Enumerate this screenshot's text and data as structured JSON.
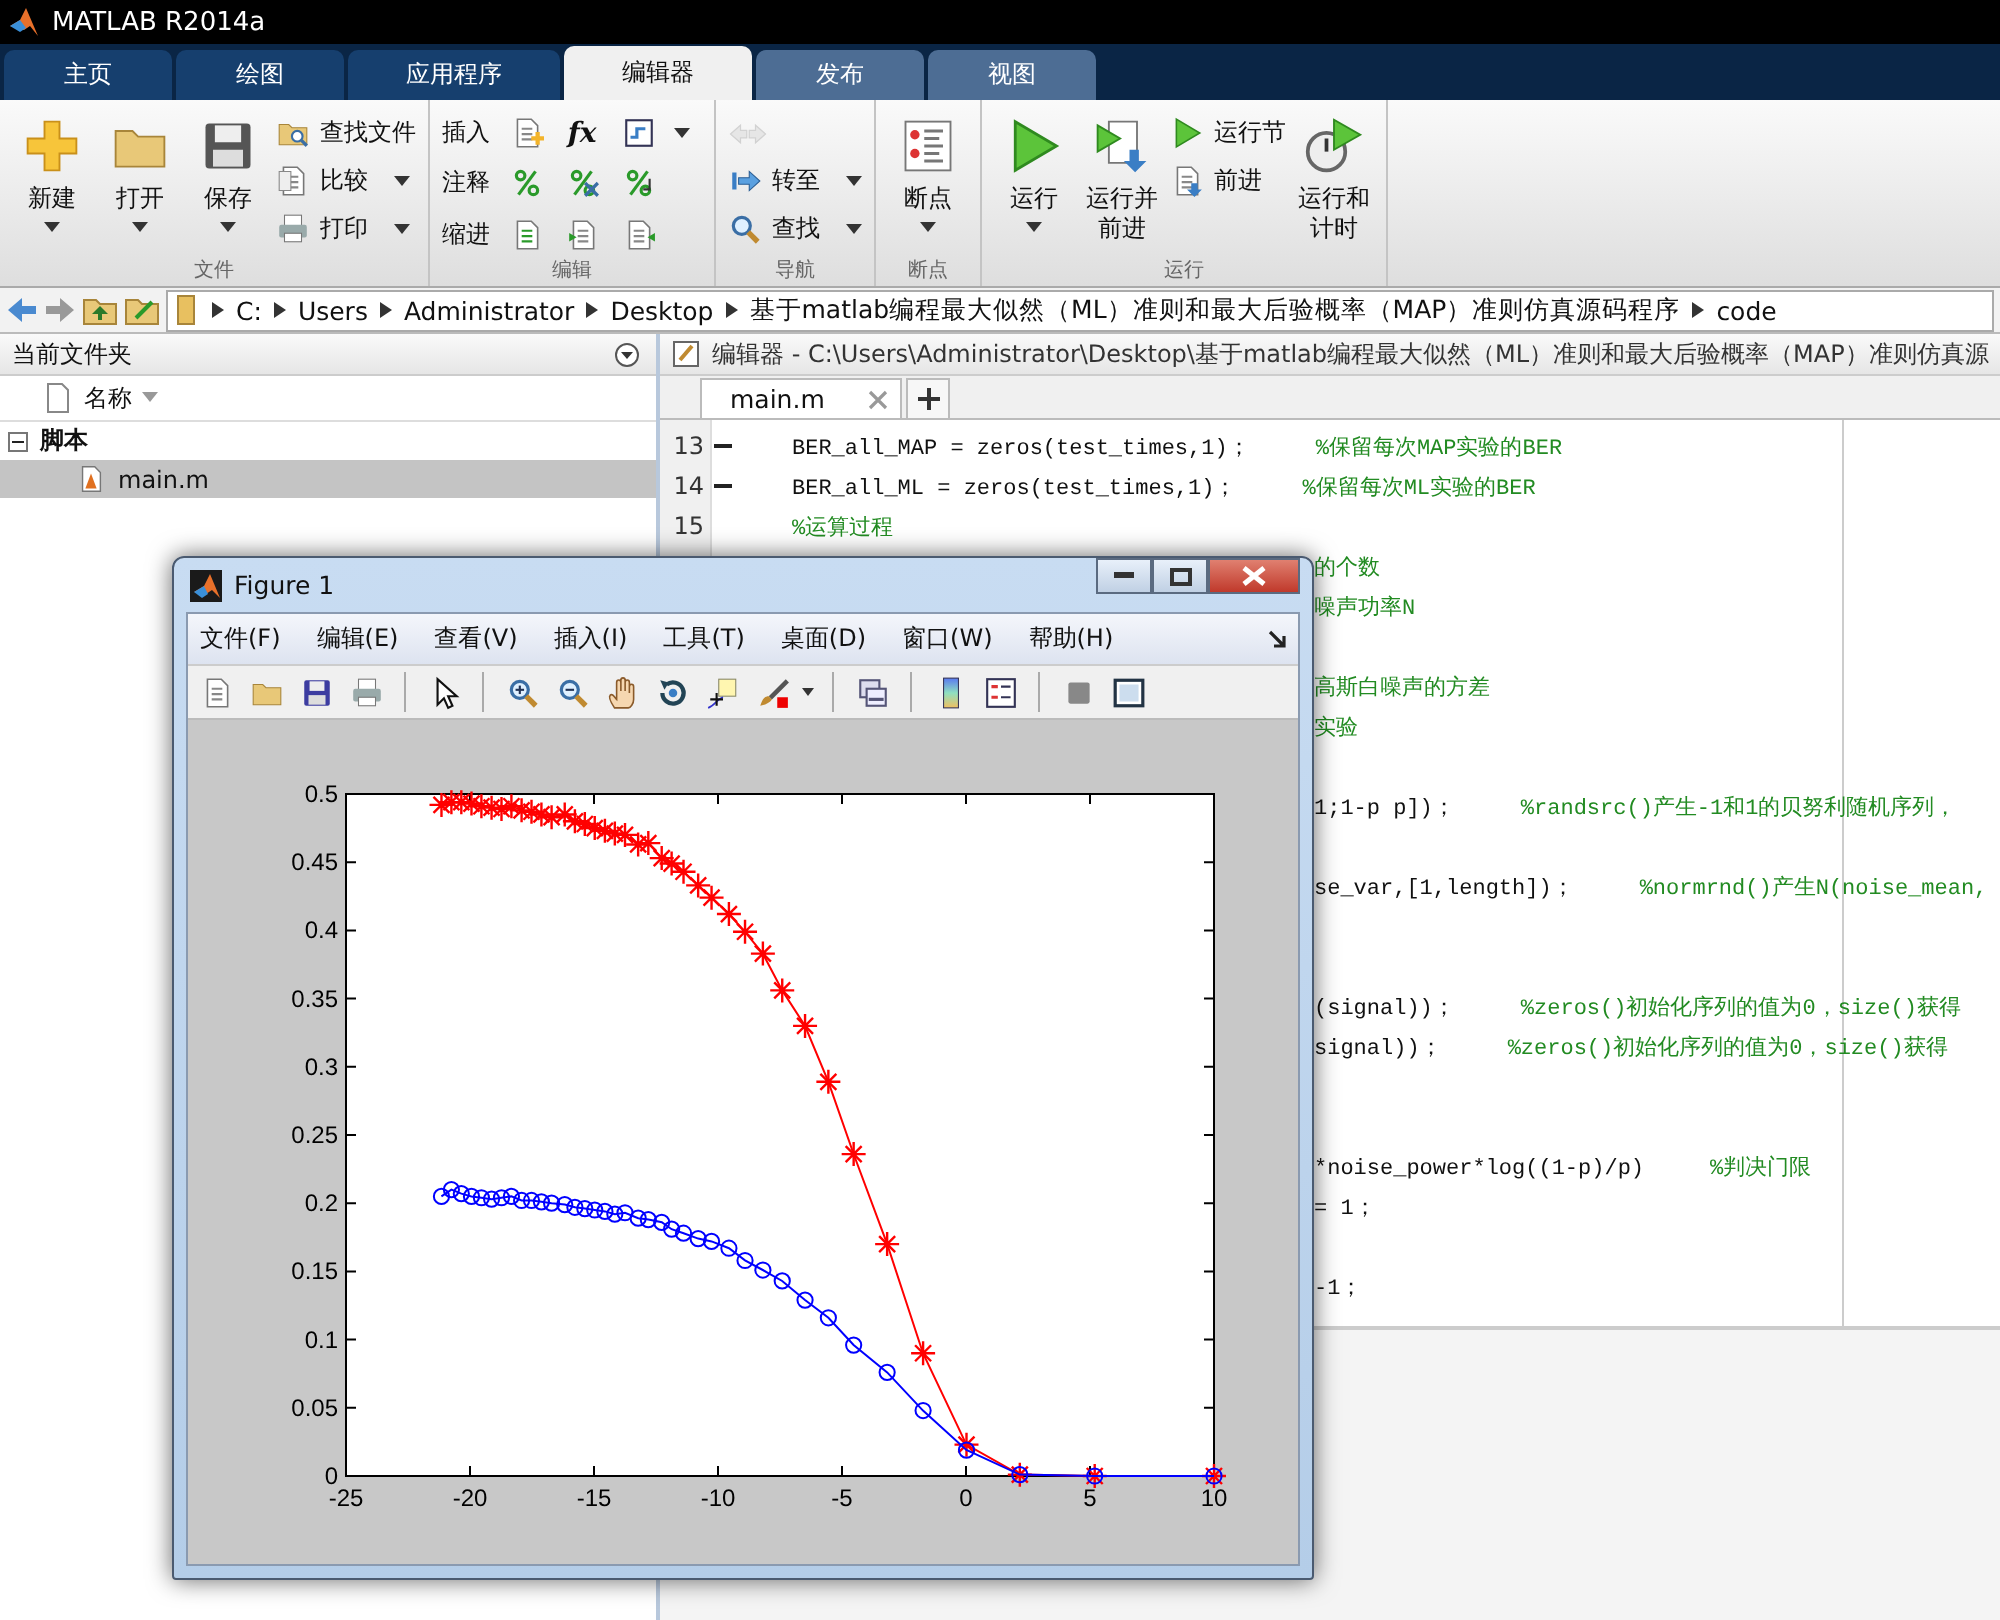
{
  "window": {
    "title": "MATLAB R2014a"
  },
  "tabs": [
    {
      "label": "主页",
      "kind": "global",
      "selected": false
    },
    {
      "label": "绘图",
      "kind": "global",
      "selected": false
    },
    {
      "label": "应用程序",
      "kind": "global",
      "selected": false
    },
    {
      "label": "编辑器",
      "kind": "contextual",
      "selected": true
    },
    {
      "label": "发布",
      "kind": "contextual",
      "selected": false
    },
    {
      "label": "视图",
      "kind": "contextual",
      "selected": false
    }
  ],
  "toolstrip": {
    "sections": [
      {
        "title": "文件",
        "items": [
          {
            "kind": "large",
            "label": "新建",
            "dropdown": true
          },
          {
            "kind": "large",
            "label": "打开",
            "dropdown": true
          },
          {
            "kind": "large",
            "label": "保存",
            "dropdown": true
          },
          {
            "kind": "stack",
            "rows": [
              {
                "kind": "button",
                "label": "查找文件",
                "dropdown": false
              },
              {
                "kind": "button",
                "label": "比较",
                "dropdown": true
              },
              {
                "kind": "button",
                "label": "打印",
                "dropdown": true
              }
            ]
          }
        ]
      },
      {
        "title": "编辑",
        "items": [
          {
            "kind": "grid",
            "labels": [
              "插入",
              "注释",
              "缩进"
            ],
            "glyph": "fx"
          }
        ]
      },
      {
        "title": "导航",
        "items": [
          {
            "kind": "stack",
            "rows": [
              {
                "kind": "arrows",
                "disabled": true
              },
              {
                "kind": "button",
                "label": "转至",
                "dropdown": true
              },
              {
                "kind": "button",
                "label": "查找",
                "dropdown": true
              }
            ]
          }
        ]
      },
      {
        "title": "断点",
        "items": [
          {
            "kind": "large",
            "label": "断点",
            "dropdown": true
          }
        ]
      },
      {
        "title": "运行",
        "items": [
          {
            "kind": "large",
            "label": "运行",
            "dropdown": true
          },
          {
            "kind": "large",
            "label": "运行并前进",
            "dropdown": false
          },
          {
            "kind": "stack",
            "rows": [
              {
                "kind": "button",
                "label": "运行节",
                "dropdown": false
              },
              {
                "kind": "button",
                "label": "前进",
                "dropdown": false
              }
            ]
          },
          {
            "kind": "large",
            "label": "运行和计时",
            "dropdown": false
          }
        ]
      }
    ]
  },
  "address": {
    "segments": [
      "C:",
      "Users",
      "Administrator",
      "Desktop",
      "基于matlab编程最大似然（ML）准则和最大后验概率（MAP）准则仿真源码程序",
      "code"
    ]
  },
  "folder_panel": {
    "title": "当前文件夹",
    "column": "名称",
    "tree": [
      {
        "label": "脚本",
        "expanded": true,
        "selected": false,
        "children": [
          {
            "label": "main.m",
            "selected": true
          }
        ]
      }
    ]
  },
  "editor": {
    "title": "编辑器 - C:\\Users\\Administrator\\Desktop\\基于matlab编程最大似然（ML）准则和最大后验概率（MAP）准则仿真源",
    "tabs": [
      {
        "label": "main.m",
        "selected": true
      }
    ],
    "lines": [
      {
        "kind": "full",
        "number": "13",
        "executable": true,
        "code": "BER_all_MAP = zeros(test_times,1)；",
        "comment": "%保留每次MAP实验的BER"
      },
      {
        "kind": "full",
        "number": "14",
        "executable": true,
        "code": "BER_all_ML = zeros(test_times,1)；",
        "comment": "%保留每次ML实验的BER"
      },
      {
        "kind": "full",
        "number": "15",
        "executable": false,
        "comment": "%运算过程"
      },
      {
        "kind": "fragment",
        "comment": "的个数"
      },
      {
        "kind": "fragment",
        "comment": "噪声功率N"
      },
      {
        "kind": "blank"
      },
      {
        "kind": "fragment",
        "comment": "高斯白噪声的方差"
      },
      {
        "kind": "fragment",
        "comment": "实验"
      },
      {
        "kind": "blank"
      },
      {
        "kind": "fragment",
        "code": "1;1-p p])；",
        "comment": "%randsrc()产生-1和1的贝努利随机序列，"
      },
      {
        "kind": "blank"
      },
      {
        "kind": "fragment",
        "code": "se_var,[1,length])；",
        "comment": "%normrnd()产生N(noise_mean,"
      },
      {
        "kind": "blank"
      },
      {
        "kind": "blank"
      },
      {
        "kind": "fragment",
        "code": "(signal))；",
        "comment": "%zeros()初始化序列的值为0，size()获得"
      },
      {
        "kind": "fragment",
        "code": "signal))；",
        "comment": "%zeros()初始化序列的值为0，size()获得"
      },
      {
        "kind": "blank"
      },
      {
        "kind": "blank"
      },
      {
        "kind": "fragment",
        "code": "*noise_power*log((1-p)/p)",
        "comment": "%判决门限"
      },
      {
        "kind": "fragment",
        "code": "= 1；"
      },
      {
        "kind": "blank"
      },
      {
        "kind": "fragment",
        "code": "-1；"
      }
    ]
  },
  "figure": {
    "title": "Figure 1",
    "menu": [
      "文件(F)",
      "编辑(E)",
      "查看(V)",
      "插入(I)",
      "工具(T)",
      "桌面(D)",
      "窗口(W)",
      "帮助(H)"
    ],
    "chart_data": {
      "type": "line",
      "x": [
        -21.15,
        -20.75,
        -20.35,
        -19.94,
        -19.54,
        -19.13,
        -18.73,
        -18.33,
        -17.92,
        -17.52,
        -17.12,
        -16.71,
        -16.18,
        -15.77,
        -15.37,
        -14.97,
        -14.56,
        -14.16,
        -13.75,
        -13.22,
        -12.81,
        -12.27,
        -11.87,
        -11.39,
        -10.8,
        -10.26,
        -9.56,
        -8.91,
        -8.19,
        -7.41,
        -6.49,
        -5.55,
        -4.53,
        -3.18,
        -1.73,
        0.02,
        2.17,
        5.19,
        10
      ],
      "series": [
        {
          "color": "#ff0000",
          "marker": "cross",
          "values": [
            0.492,
            0.494,
            0.494,
            0.493,
            0.491,
            0.49,
            0.489,
            0.491,
            0.488,
            0.487,
            0.485,
            0.483,
            0.485,
            0.48,
            0.478,
            0.475,
            0.473,
            0.471,
            0.47,
            0.463,
            0.464,
            0.453,
            0.449,
            0.443,
            0.433,
            0.424,
            0.412,
            0.399,
            0.383,
            0.356,
            0.33,
            0.289,
            0.236,
            0.17,
            0.09,
            0.023,
            0.001,
            0,
            0
          ]
        },
        {
          "color": "#0000ff",
          "marker": "circle",
          "values": [
            0.205,
            0.21,
            0.207,
            0.205,
            0.204,
            0.203,
            0.204,
            0.205,
            0.202,
            0.202,
            0.201,
            0.2,
            0.199,
            0.197,
            0.196,
            0.195,
            0.194,
            0.192,
            0.193,
            0.189,
            0.188,
            0.186,
            0.181,
            0.178,
            0.174,
            0.172,
            0.167,
            0.158,
            0.151,
            0.143,
            0.129,
            0.116,
            0.096,
            0.076,
            0.048,
            0.019,
            0.001,
            0,
            0
          ]
        }
      ],
      "xlim": [
        -25,
        10
      ],
      "ylim": [
        0,
        0.5
      ],
      "xticks": [
        -25,
        -20,
        -15,
        -10,
        -5,
        0,
        5,
        10
      ],
      "yticks": [
        0,
        0.05,
        0.1,
        0.15,
        0.2,
        0.25,
        0.3,
        0.35,
        0.4,
        0.45,
        0.5
      ]
    }
  }
}
